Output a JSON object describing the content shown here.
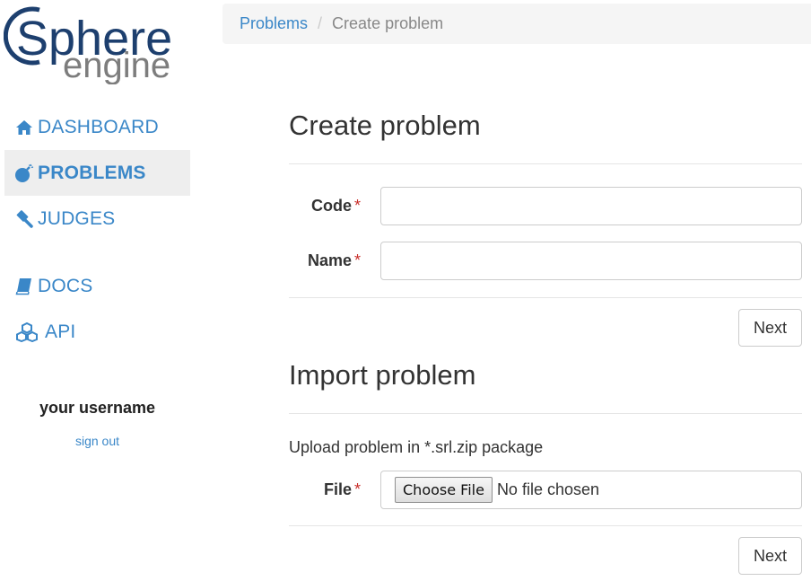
{
  "logo": {
    "line1": "Sphere",
    "line2": "engine"
  },
  "sidebar": {
    "items": [
      {
        "label": "DASHBOARD",
        "icon": "home-icon",
        "active": false
      },
      {
        "label": "PROBLEMS",
        "icon": "bomb-icon",
        "active": true
      },
      {
        "label": "JUDGES",
        "icon": "gavel-icon",
        "active": false
      },
      {
        "label": "DOCS",
        "icon": "book-icon",
        "active": false
      },
      {
        "label": "API",
        "icon": "cubes-icon",
        "active": false
      }
    ],
    "username": "your username",
    "signout": "sign out"
  },
  "breadcrumb": {
    "parent": "Problems",
    "separator": "/",
    "current": "Create problem"
  },
  "create": {
    "title": "Create problem",
    "code_label": "Code",
    "name_label": "Name",
    "required_mark": "*",
    "code_value": "",
    "name_value": "",
    "next_label": "Next"
  },
  "import": {
    "title": "Import problem",
    "help": "Upload problem in *.srl.zip package",
    "file_label": "File",
    "choose_file_label": "Choose File",
    "file_status": "No file chosen",
    "next_label": "Next"
  },
  "colors": {
    "link": "#3a87c8",
    "logo_blue": "#1d3f6e",
    "logo_gray": "#7d7d7d",
    "required": "#c9302c"
  }
}
